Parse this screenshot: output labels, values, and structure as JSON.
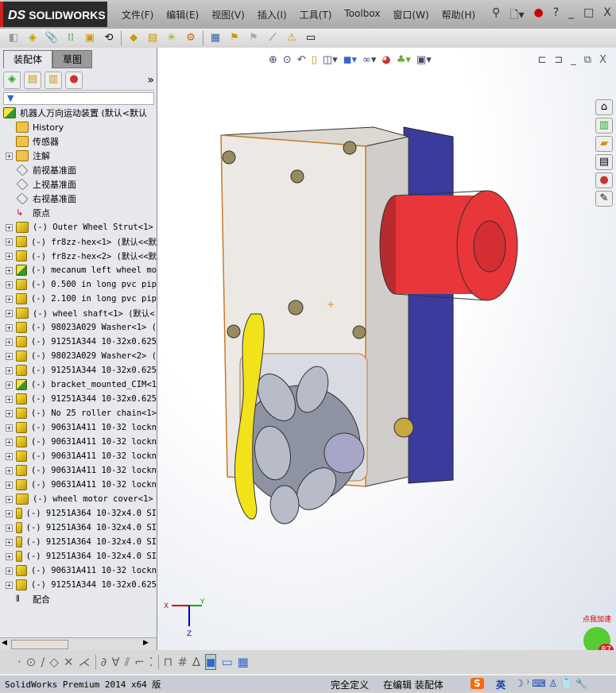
{
  "app": {
    "logo": "SOLIDWORKS",
    "logo_prefix": "DS"
  },
  "menu": [
    "文件(F)",
    "编辑(E)",
    "视图(V)",
    "插入(I)",
    "工具(T)",
    "Toolbox",
    "窗口(W)",
    "帮助(H)"
  ],
  "window_controls": {
    "help": "?",
    "minimize": "_",
    "restore": "□",
    "close": "X"
  },
  "left_panel": {
    "tabs": [
      "装配体",
      "草图"
    ],
    "active_tab": "装配体",
    "filter_icon": "filter-icon",
    "collapse": "»",
    "tree": [
      {
        "label": "机器人万向运动装置  (默认<默认",
        "icon": "asm",
        "expand": false,
        "level": 0
      },
      {
        "label": "History",
        "icon": "folder",
        "expand": false,
        "level": 1
      },
      {
        "label": "传感器",
        "icon": "folder",
        "expand": false,
        "level": 1
      },
      {
        "label": "注解",
        "icon": "folder",
        "expand": true,
        "level": 1
      },
      {
        "label": "前视基准面",
        "icon": "plane",
        "expand": false,
        "level": 1
      },
      {
        "label": "上视基准面",
        "icon": "plane",
        "expand": false,
        "level": 1
      },
      {
        "label": "右视基准面",
        "icon": "plane",
        "expand": false,
        "level": 1
      },
      {
        "label": "原点",
        "icon": "origin",
        "expand": false,
        "level": 1
      },
      {
        "label": "(-) Outer Wheel Strut<1>",
        "icon": "part",
        "expand": true,
        "level": 1
      },
      {
        "label": "(-) fr8zz-hex<1> (默认<<默",
        "icon": "part",
        "expand": true,
        "level": 1
      },
      {
        "label": "(-) fr8zz-hex<2> (默认<<默",
        "icon": "part",
        "expand": true,
        "level": 1
      },
      {
        "label": "(-) mecanum left wheel mo",
        "icon": "asm",
        "expand": true,
        "level": 1
      },
      {
        "label": "(-) 0.500 in long pvc pip",
        "icon": "part",
        "expand": true,
        "level": 1
      },
      {
        "label": "(-) 2.100 in long pvc pip",
        "icon": "part",
        "expand": true,
        "level": 1
      },
      {
        "label": "(-) wheel shaft<1> (默认<",
        "icon": "part",
        "expand": true,
        "level": 1
      },
      {
        "label": "(-) 98023A029 Washer<1> (",
        "icon": "part",
        "expand": true,
        "level": 1
      },
      {
        "label": "(-) 91251A344 10-32x0.625",
        "icon": "part",
        "expand": true,
        "level": 1
      },
      {
        "label": "(-) 98023A029 Washer<2> (",
        "icon": "part",
        "expand": true,
        "level": 1
      },
      {
        "label": "(-) 91251A344 10-32x0.625",
        "icon": "part",
        "expand": true,
        "level": 1
      },
      {
        "label": "(-) bracket_mounted_CIM<1",
        "icon": "asm",
        "expand": true,
        "level": 1
      },
      {
        "label": "(-) 91251A344 10-32x0.625",
        "icon": "part",
        "expand": true,
        "level": 1
      },
      {
        "label": "(-) No 25 roller chain<1>",
        "icon": "part",
        "expand": true,
        "level": 1
      },
      {
        "label": "(-) 90631A411 10-32 lockn",
        "icon": "part",
        "expand": true,
        "level": 1
      },
      {
        "label": "(-) 90631A411 10-32 lockn",
        "icon": "part",
        "expand": true,
        "level": 1
      },
      {
        "label": "(-) 90631A411 10-32 lockn",
        "icon": "part",
        "expand": true,
        "level": 1
      },
      {
        "label": "(-) 90631A411 10-32 lockn",
        "icon": "part",
        "expand": true,
        "level": 1
      },
      {
        "label": "(-) 90631A411 10-32 lockn",
        "icon": "part",
        "expand": true,
        "level": 1
      },
      {
        "label": "(-) wheel motor cover<1>",
        "icon": "part",
        "expand": true,
        "level": 1
      },
      {
        "label": "(-) 91251A364 10-32x4.0 SI",
        "icon": "part",
        "expand": true,
        "level": 1
      },
      {
        "label": "(-) 91251A364 10-32x4.0 SI",
        "icon": "part",
        "expand": true,
        "level": 1
      },
      {
        "label": "(-) 91251A364 10-32x4.0 SI",
        "icon": "part",
        "expand": true,
        "level": 1
      },
      {
        "label": "(-) 91251A364 10-32x4.0 SI",
        "icon": "part",
        "expand": true,
        "level": 1
      },
      {
        "label": "(-) 90631A411 10-32 lockn",
        "icon": "part",
        "expand": true,
        "level": 1
      },
      {
        "label": "(-) 91251A344 10-32x0.625",
        "icon": "part",
        "expand": true,
        "level": 1
      },
      {
        "label": "配合",
        "icon": "mates",
        "expand": false,
        "level": 1
      }
    ]
  },
  "triad": {
    "x": "X",
    "y": "Y",
    "z": "Z"
  },
  "status": {
    "product": "SolidWorks Premium 2014 x64 版",
    "definition": "完全定义",
    "mode": "在编辑 装配体",
    "ime": "英"
  },
  "badge": {
    "text": "点我加速",
    "count": "87"
  },
  "colors": {
    "motor": "#e8363a",
    "panel": "#3a3a9a",
    "chain": "#f2e21a",
    "plate": "#ece9e4"
  }
}
